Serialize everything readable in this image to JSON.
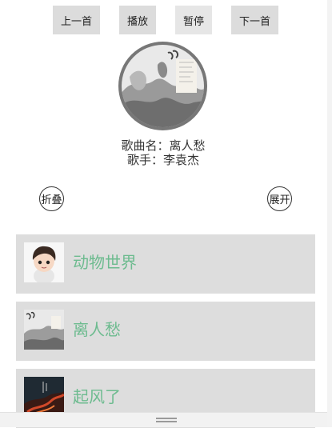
{
  "controls": {
    "prev_label": "上一首",
    "play_label": "播放",
    "pause_label": "暂停",
    "next_label": "下一首"
  },
  "now_playing": {
    "song_line": "歌曲名：离人愁",
    "artist_line": "歌手：李袁杰"
  },
  "panel": {
    "collapse_label": "折叠",
    "expand_label": "展开"
  },
  "playlist": [
    {
      "title": "动物世界",
      "thumb": "cartoon-boy-avatar"
    },
    {
      "title": "离人愁",
      "thumb": "ink-wash-landscape"
    },
    {
      "title": "起风了",
      "thumb": "dark-red-night-scene"
    }
  ],
  "colors": {
    "button_bg": "#dcdcdc",
    "item_bg": "#dddddd",
    "song_title": "#6dbb8f"
  }
}
